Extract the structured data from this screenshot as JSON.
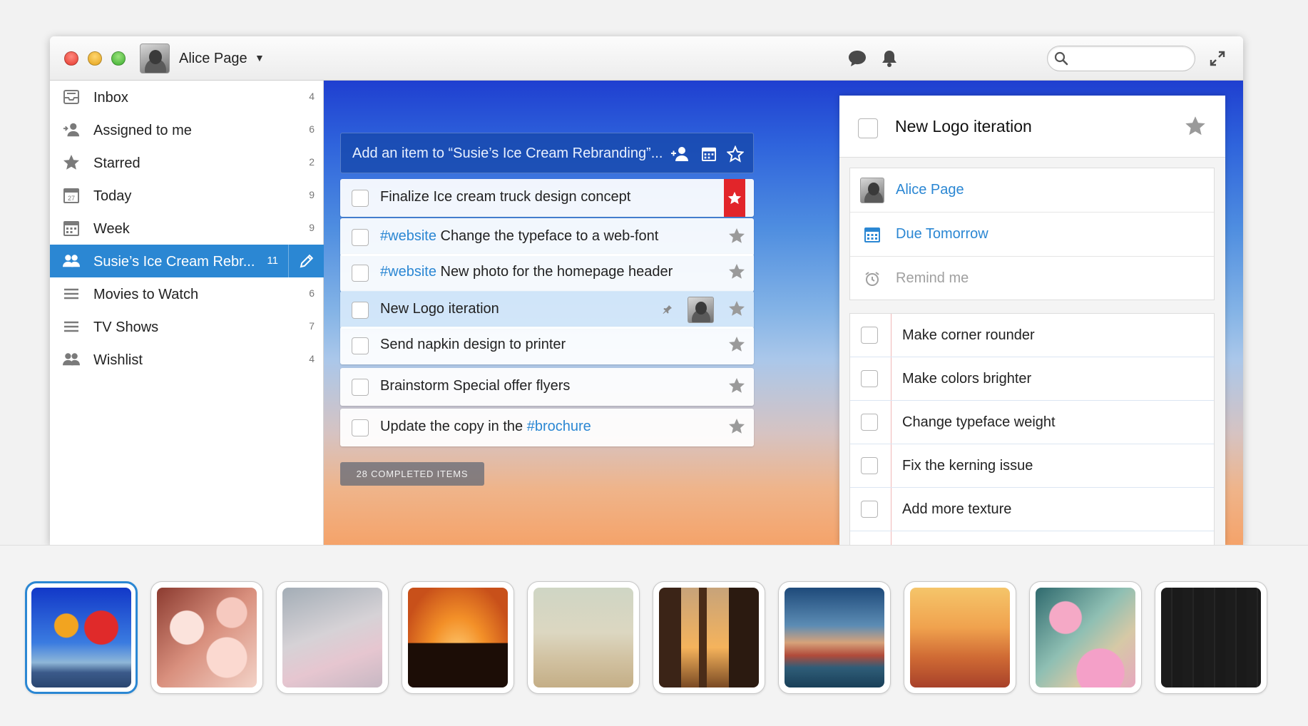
{
  "titlebar": {
    "user_name": "Alice Page",
    "caret": "▼",
    "icons": [
      "chat-bubble-icon",
      "bell-icon",
      "search-icon",
      "expand-icon"
    ],
    "search_placeholder": ""
  },
  "sidebar": {
    "items": [
      {
        "label": "Inbox",
        "count": "4",
        "icon": "inbox-icon"
      },
      {
        "label": "Assigned to me",
        "count": "6",
        "icon": "assigned-user-icon"
      },
      {
        "label": "Starred",
        "count": "2",
        "icon": "star-icon"
      },
      {
        "label": "Today",
        "count": "9",
        "icon": "calendar-today-icon"
      },
      {
        "label": "Week",
        "count": "9",
        "icon": "calendar-week-icon"
      },
      {
        "label": "Susie’s Ice Cream Rebr...",
        "count": "11",
        "icon": "shared-list-icon",
        "active": true
      },
      {
        "label": "Movies to Watch",
        "count": "6",
        "icon": "list-icon"
      },
      {
        "label": "TV Shows",
        "count": "7",
        "icon": "list-icon"
      },
      {
        "label": "Wishlist",
        "count": "4",
        "icon": "shared-list-icon"
      }
    ]
  },
  "main": {
    "add_placeholder": "Add an item to “Susie’s Ice Cream Rebranding”...",
    "tasks": [
      {
        "tag": "",
        "text": "Finalize Ice cream truck design concept",
        "tag_after": "",
        "starred": true
      },
      {
        "tag": "#website",
        "text": " Change the typeface to a web-font",
        "tag_after": "",
        "starred": false
      },
      {
        "tag": "#website",
        "text": " New photo for the homepage header",
        "tag_after": "",
        "starred": false
      },
      {
        "tag": "",
        "text": "New Logo iteration",
        "tag_after": "",
        "starred": false,
        "selected": true
      },
      {
        "tag": "",
        "text": "Send napkin design to printer",
        "tag_after": "",
        "starred": false
      },
      {
        "tag": "",
        "text": "Brainstorm Special offer flyers",
        "tag_after": "",
        "starred": false
      },
      {
        "tag": "",
        "text": "Update the copy in the ",
        "tag_after": "#brochure",
        "starred": false
      }
    ],
    "completed_label": "28 COMPLETED ITEMS"
  },
  "detail": {
    "title": "New Logo iteration",
    "assignee": "Alice Page",
    "due": "Due Tomorrow",
    "remind": "Remind me",
    "subtasks": [
      "Make corner rounder",
      "Make colors brighter",
      "Change typeface weight",
      "Fix the kerning issue",
      "Add more texture"
    ]
  },
  "backgrounds": [
    {
      "name": "hot-air-balloons",
      "selected": true
    },
    {
      "name": "cherry-blossoms"
    },
    {
      "name": "frosted-branches"
    },
    {
      "name": "sunset-temple"
    },
    {
      "name": "sand-dune"
    },
    {
      "name": "city-street-sunset"
    },
    {
      "name": "venice-canal"
    },
    {
      "name": "paris-sunset"
    },
    {
      "name": "pink-flowers"
    },
    {
      "name": "dark-wood"
    }
  ],
  "colors": {
    "accent": "#2b87d3",
    "ribbon": "#e2252a",
    "hashtag": "#2b87d3"
  }
}
